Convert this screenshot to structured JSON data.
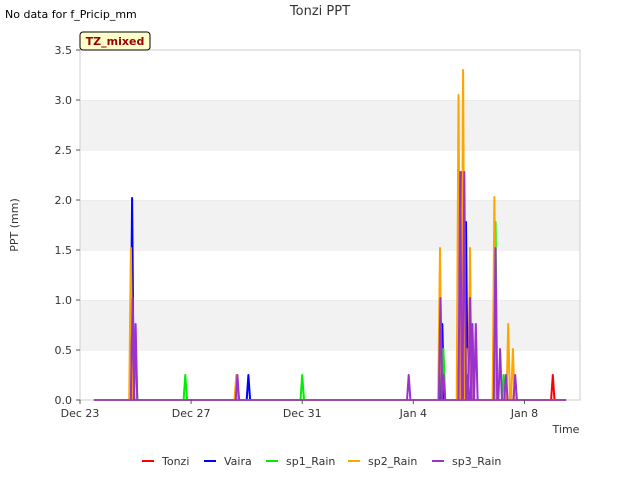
{
  "no_data_note": "No data for f_Pricip_mm",
  "badge": {
    "label": "TZ_mixed",
    "bg": "#ffffcc",
    "fg": "#990000"
  },
  "chart_data": {
    "type": "line",
    "title": "Tonzi PPT",
    "xlabel": "Time",
    "ylabel": "PPT (mm)",
    "xlim": [
      "2023-12-23",
      "2024-01-10"
    ],
    "ylim": [
      0,
      3.5
    ],
    "x_ticks": [
      {
        "date": "2023-12-23",
        "label": "Dec 23"
      },
      {
        "date": "2023-12-27",
        "label": "Dec 27"
      },
      {
        "date": "2023-12-31",
        "label": "Dec 31"
      },
      {
        "date": "2024-01-04",
        "label": "Jan 4"
      },
      {
        "date": "2024-01-08",
        "label": "Jan 8"
      }
    ],
    "y_ticks": [
      0.0,
      0.5,
      1.0,
      1.5,
      2.0,
      2.5,
      3.0,
      3.5
    ],
    "y_tick_labels": [
      "0.0",
      "0.5",
      "1.0",
      "1.5",
      "2.0",
      "2.5",
      "3.0",
      "3.5"
    ],
    "x_range_data": [
      "2023-12-23T12:00",
      "2024-01-09T12:00"
    ],
    "grid": "horizontal bands",
    "legend_position": "bottom",
    "series": [
      {
        "name": "Tonzi",
        "color": "#ff0000",
        "points": [
          [
            "2024-01-09T00:30",
            0.25
          ]
        ]
      },
      {
        "name": "Vaira",
        "color": "#0000ff",
        "points": [
          [
            "2023-12-24T21:00",
            2.02
          ],
          [
            "2023-12-29T01:30",
            0.25
          ],
          [
            "2024-01-05T01:00",
            0.76
          ],
          [
            "2024-01-05T16:00",
            0.76
          ],
          [
            "2024-01-05T18:00",
            2.28
          ],
          [
            "2024-01-05T19:00",
            0.25
          ],
          [
            "2024-01-05T20:00",
            1.27
          ],
          [
            "2024-01-05T21:30",
            1.78
          ]
        ]
      },
      {
        "name": "sp1_Rain",
        "color": "#00ee00",
        "points": [
          [
            "2023-12-25T00:00",
            0.51
          ],
          [
            "2023-12-26T19:00",
            0.25
          ],
          [
            "2023-12-31T00:00",
            0.25
          ],
          [
            "2024-01-05T02:00",
            0.51
          ],
          [
            "2024-01-06T23:00",
            1.78
          ],
          [
            "2024-01-07T06:00",
            0.25
          ]
        ]
      },
      {
        "name": "sp2_Rain",
        "color": "#ffa500",
        "points": [
          [
            "2023-12-24T20:00",
            1.52
          ],
          [
            "2023-12-28T15:00",
            0.25
          ],
          [
            "2024-01-04T23:00",
            1.52
          ],
          [
            "2024-01-05T15:00",
            3.05
          ],
          [
            "2024-01-05T19:00",
            3.3
          ],
          [
            "2024-01-05T22:00",
            0.51
          ],
          [
            "2024-01-06T01:00",
            1.52
          ],
          [
            "2024-01-06T03:00",
            0.76
          ],
          [
            "2024-01-06T22:00",
            2.03
          ],
          [
            "2024-01-07T10:00",
            0.76
          ],
          [
            "2024-01-07T14:00",
            0.51
          ]
        ]
      },
      {
        "name": "sp3_Rain",
        "color": "#9a32cd",
        "points": [
          [
            "2023-12-24T21:30",
            1.02
          ],
          [
            "2023-12-25T00:00",
            0.76
          ],
          [
            "2023-12-28T16:00",
            0.25
          ],
          [
            "2024-01-03T20:00",
            0.25
          ],
          [
            "2024-01-04T23:30",
            1.02
          ],
          [
            "2024-01-05T02:00",
            0.25
          ],
          [
            "2024-01-05T16:30",
            2.28
          ],
          [
            "2024-01-05T20:00",
            2.28
          ],
          [
            "2024-01-05T23:00",
            0.25
          ],
          [
            "2024-01-06T01:00",
            1.02
          ],
          [
            "2024-01-06T03:00",
            0.76
          ],
          [
            "2024-01-06T06:00",
            0.76
          ],
          [
            "2024-01-06T23:00",
            1.52
          ],
          [
            "2024-01-07T03:00",
            0.51
          ],
          [
            "2024-01-07T08:00",
            0.25
          ],
          [
            "2024-01-07T16:00",
            0.25
          ]
        ]
      }
    ]
  }
}
